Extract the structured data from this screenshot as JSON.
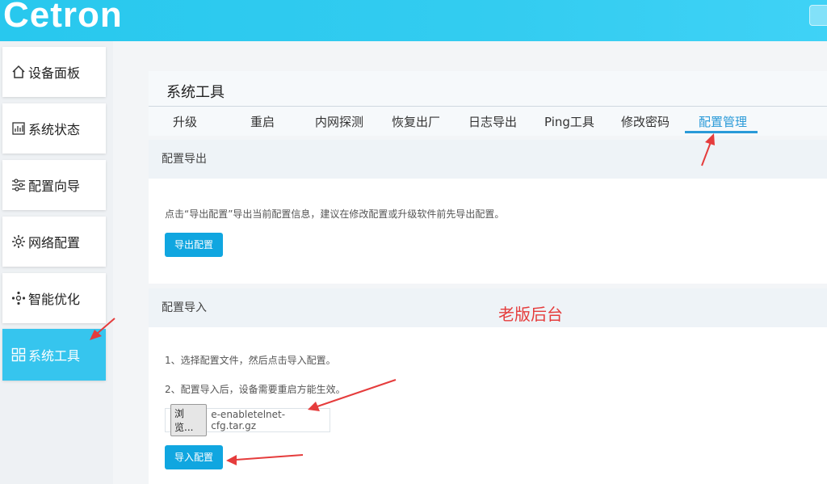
{
  "brand": {
    "logo_text": "Cetron"
  },
  "sidebar": {
    "items": [
      {
        "label": "设备面板",
        "icon": "home-icon"
      },
      {
        "label": "系统状态",
        "icon": "chart-icon"
      },
      {
        "label": "配置向导",
        "icon": "sliders-icon"
      },
      {
        "label": "网络配置",
        "icon": "gear-icon"
      },
      {
        "label": "智能优化",
        "icon": "nodes-icon"
      },
      {
        "label": "系统工具",
        "icon": "grid-icon",
        "active": true
      }
    ]
  },
  "page": {
    "title": "系统工具",
    "tabs": [
      {
        "label": "升级"
      },
      {
        "label": "重启"
      },
      {
        "label": "内网探测"
      },
      {
        "label": "恢复出厂"
      },
      {
        "label": "日志导出"
      },
      {
        "label": "Ping工具"
      },
      {
        "label": "修改密码"
      },
      {
        "label": "配置管理",
        "active": true
      }
    ]
  },
  "export_section": {
    "title": "配置导出",
    "description": "点击“导出配置”导出当前配置信息，建议在修改配置或升级软件前先导出配置。",
    "button_label": "导出配置"
  },
  "import_section": {
    "title": "配置导入",
    "step1": "1、选择配置文件，然后点击导入配置。",
    "step2": "2、配置导入后，设备需要重启方能生效。",
    "browse_label": "浏览...",
    "file_name": "e-enabletelnet-cfg.tar.gz",
    "button_label": "导入配置"
  },
  "annotation": {
    "text": "老版后台",
    "color": "#e53c3c"
  },
  "colors": {
    "accent": "#2a9ad8",
    "topbar": "#33ccf0",
    "button": "#10a6e0",
    "sidebar_active": "#36c5ee"
  }
}
